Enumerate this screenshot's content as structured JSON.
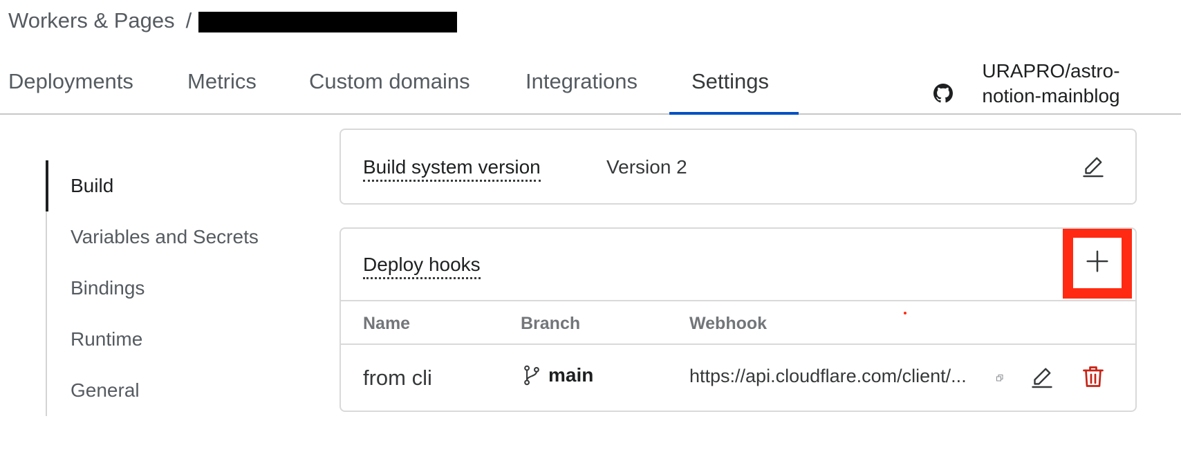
{
  "breadcrumb": {
    "root": "Workers & Pages",
    "separator": "/"
  },
  "tabs": [
    {
      "label": "Deployments"
    },
    {
      "label": "Metrics"
    },
    {
      "label": "Custom domains"
    },
    {
      "label": "Integrations"
    },
    {
      "label": "Settings",
      "active": true
    }
  ],
  "repo": {
    "icon": "github-icon",
    "name": "URAPRO/astro-notion-mainblog"
  },
  "sidenav": {
    "items": [
      {
        "label": "Build",
        "active": true
      },
      {
        "label": "Variables and Secrets"
      },
      {
        "label": "Bindings"
      },
      {
        "label": "Runtime"
      },
      {
        "label": "General"
      }
    ]
  },
  "build_system": {
    "label": "Build system version",
    "value": "Version 2",
    "edit_icon": "pencil-icon"
  },
  "deploy_hooks": {
    "label": "Deploy hooks",
    "add_icon": "plus-icon",
    "columns": [
      "Name",
      "Branch",
      "Webhook"
    ],
    "rows": [
      {
        "name": "from cli",
        "branch": "main",
        "webhook": "https://api.cloudflare.com/client/..."
      }
    ]
  },
  "colors": {
    "accent": "#0051c3",
    "highlight": "#ff2a11",
    "danger": "#c82215"
  }
}
